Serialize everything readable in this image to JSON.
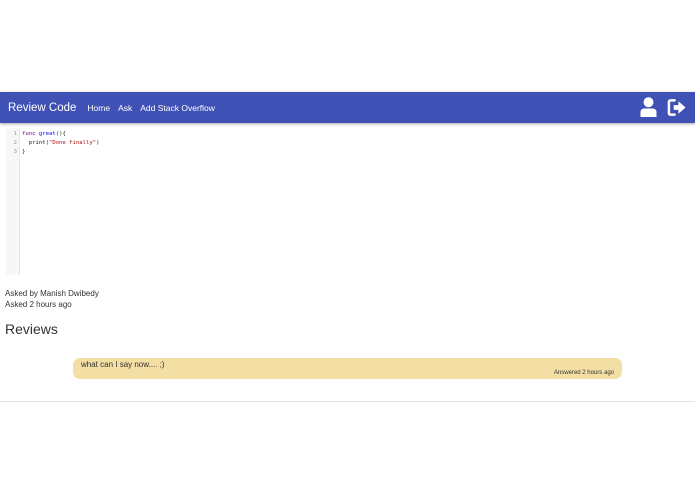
{
  "navbar": {
    "brand": "Review Code",
    "links": [
      "Home",
      "Ask",
      "Add Stack Overflow"
    ],
    "icons": [
      "user-icon",
      "sign-out-icon"
    ],
    "background": "#3f51b5"
  },
  "editor": {
    "line_numbers": [
      "1",
      "2",
      "3"
    ],
    "code": {
      "line1_keyword": "func",
      "line1_name": "great",
      "line1_rest": "(){",
      "line2_call": "  print(",
      "line2_string": "\"Done finally\"",
      "line2_end": ")",
      "line3": "}"
    }
  },
  "question": {
    "asked_by": "Asked by Manish Dwibedy",
    "asked_time": "Asked 2 hours ago"
  },
  "reviews": {
    "heading": "Reviews",
    "items": [
      {
        "text": "what can I say now.... ;)",
        "time": "Answered 2 hours ago",
        "background": "#f3dea3"
      }
    ]
  }
}
